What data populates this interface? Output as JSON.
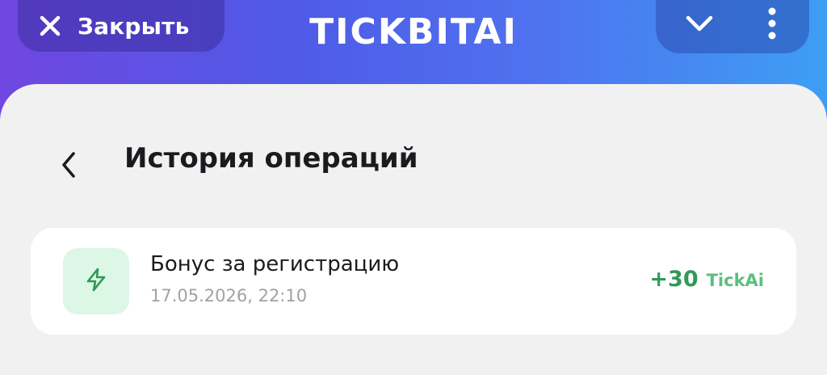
{
  "header": {
    "close_label": "Закрыть",
    "app_title": "TICKBITAI",
    "icons": {
      "close": "close-icon",
      "chevron": "chevron-down-icon",
      "more": "more-vertical-icon"
    }
  },
  "page": {
    "title": "История операций",
    "back_icon": "chevron-left-icon"
  },
  "operations": [
    {
      "title": "Бонус за регистрацию",
      "date": "17.05.2026, 22:10",
      "amount": "+30",
      "currency": "TickAi",
      "icon": "lightning-icon"
    }
  ],
  "colors": {
    "header_gradient": [
      "#7047e0",
      "#4f5ae6",
      "#3d9ef3"
    ],
    "sheet_bg": "#f1f1f2",
    "icon_bg": "#dcf7e6",
    "amount_green": "#2f9a55",
    "currency_green": "#59c07c"
  }
}
